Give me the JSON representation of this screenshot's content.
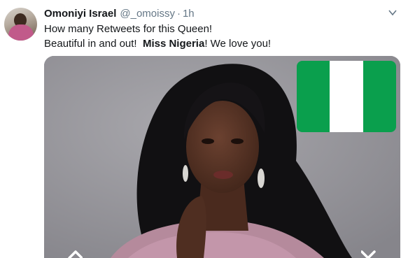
{
  "tweet": {
    "author_name": "Omoniyi Israel",
    "handle": "@_omoissy",
    "separator": "·",
    "time": "1h",
    "text_line1": "How many Retweets for this Queen!",
    "text_line2_prefix": "Beautiful in and out!",
    "text_line2_bold": "Miss Nigeria",
    "text_line2_suffix": "!  We love you!"
  },
  "icons": {
    "chevron": "chevron-down-icon",
    "left_arrow": "chevron-left-icon",
    "right_arrow": "chevron-right-icon"
  },
  "colors": {
    "flag_green": "#0a9f4d",
    "flag_white": "#ffffff",
    "text": "#14171a",
    "muted": "#657786"
  }
}
